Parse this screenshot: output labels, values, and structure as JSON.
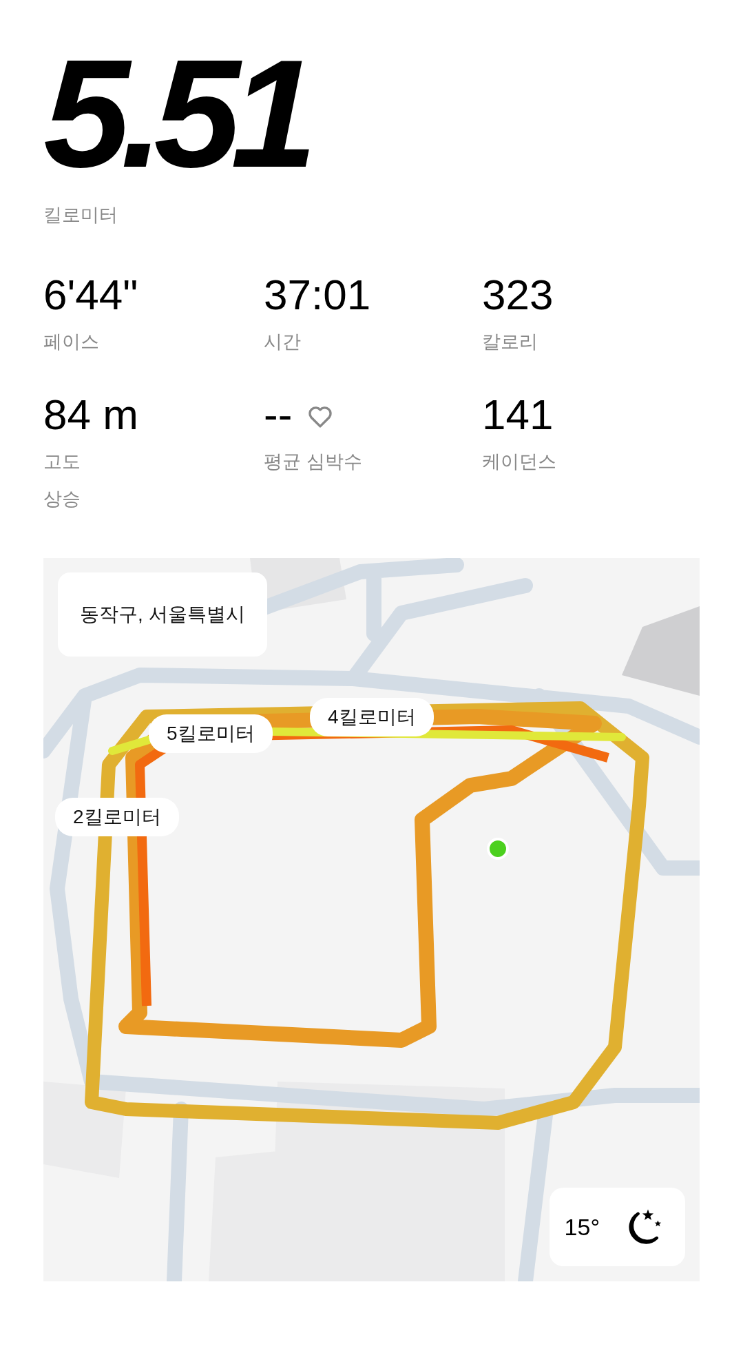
{
  "distance": {
    "value": "5.51",
    "unit": "킬로미터"
  },
  "stats": [
    {
      "value": "6'44\"",
      "label": "페이스",
      "kind": "plain"
    },
    {
      "value": "37:01",
      "label": "시간",
      "kind": "plain"
    },
    {
      "value": "323",
      "label": "칼로리",
      "kind": "plain"
    },
    {
      "value": "84 m",
      "label": "고도",
      "sublabel": "상승",
      "kind": "plain"
    },
    {
      "value": "--",
      "label": "평균 심박수",
      "kind": "heart"
    },
    {
      "value": "141",
      "label": "케이던스",
      "kind": "plain"
    }
  ],
  "map": {
    "location": "동작구, 서울특별시",
    "km_markers": [
      {
        "label": "4킬로미터"
      },
      {
        "label": "5킬로미터"
      },
      {
        "label": "2킬로미터"
      }
    ],
    "weather": {
      "temperature": "15°"
    }
  }
}
